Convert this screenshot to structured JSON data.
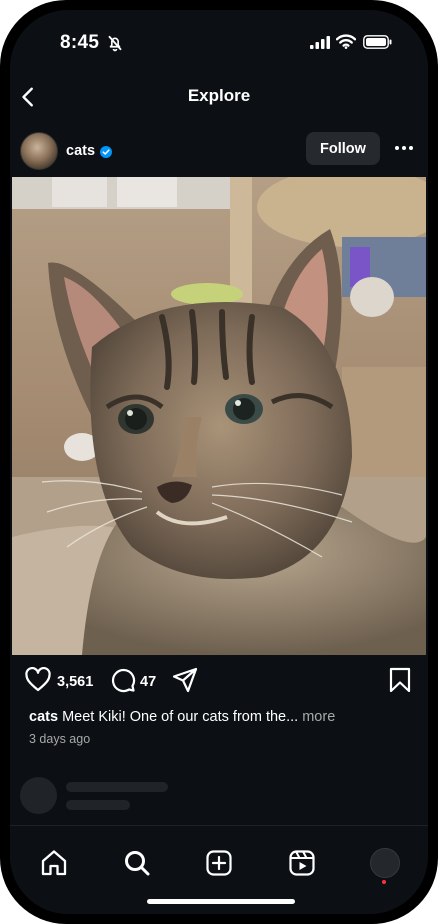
{
  "status_bar": {
    "time": "8:45"
  },
  "header": {
    "title": "Explore"
  },
  "post": {
    "username": "cats",
    "follow_label": "Follow",
    "likes": "3,561",
    "comments": "47",
    "caption_user": "cats",
    "caption_text": "Meet Kiki! One of our cats from the...",
    "caption_more": "more",
    "time_ago": "3 days ago"
  },
  "colors": {
    "background": "#0c1014",
    "verified": "#0095f6",
    "notification": "#ff3040"
  },
  "icons": [
    "back-icon",
    "verified-icon",
    "more-icon",
    "heart-icon",
    "comment-icon",
    "share-icon",
    "bookmark-icon",
    "home-icon",
    "search-icon",
    "create-icon",
    "reels-icon"
  ]
}
